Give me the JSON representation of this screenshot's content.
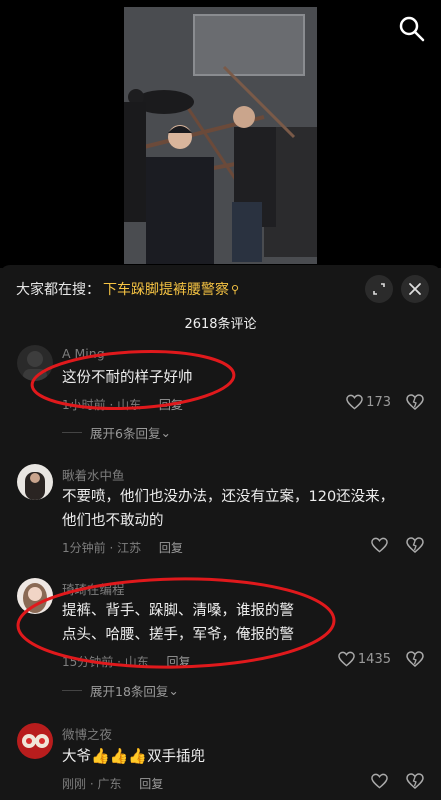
{
  "header": {
    "trend_prefix": "大家都在搜：",
    "trend_query": "下车跺脚提裤腰警察",
    "trend_icon": "search-mini-icon"
  },
  "comment_count": "2618条评论",
  "colors": {
    "trend_highlight": "#f5c343",
    "annotation_circle": "#e0191c",
    "background": "#161616"
  },
  "comments": [
    {
      "user": "A Ming",
      "text": "这份不耐的样子好帅",
      "time_location": "1小时前 · 山东",
      "reply_label": "回复",
      "likes": "173",
      "expand": "展开6条回复"
    },
    {
      "user": "瞅着水中鱼",
      "text": "不要喷，他们也没办法，还没有立案，120还没来，他们也不敢动的",
      "time_location": "1分钟前 · 江苏",
      "reply_label": "回复",
      "likes": ""
    },
    {
      "user": "琦琦在编程",
      "text": "提裤、背手、跺脚、清嗓，谁报的警\n点头、哈腰、搓手，军爷，俺报的警",
      "time_location": "15分钟前 · 山东",
      "reply_label": "回复",
      "likes": "1435",
      "expand": "展开18条回复"
    },
    {
      "user": "微博之夜",
      "text_prefix": "大爷",
      "text_suffix": "双手插兜",
      "time_location": "刚刚 · 广东",
      "reply_label": "回复",
      "likes": ""
    }
  ]
}
